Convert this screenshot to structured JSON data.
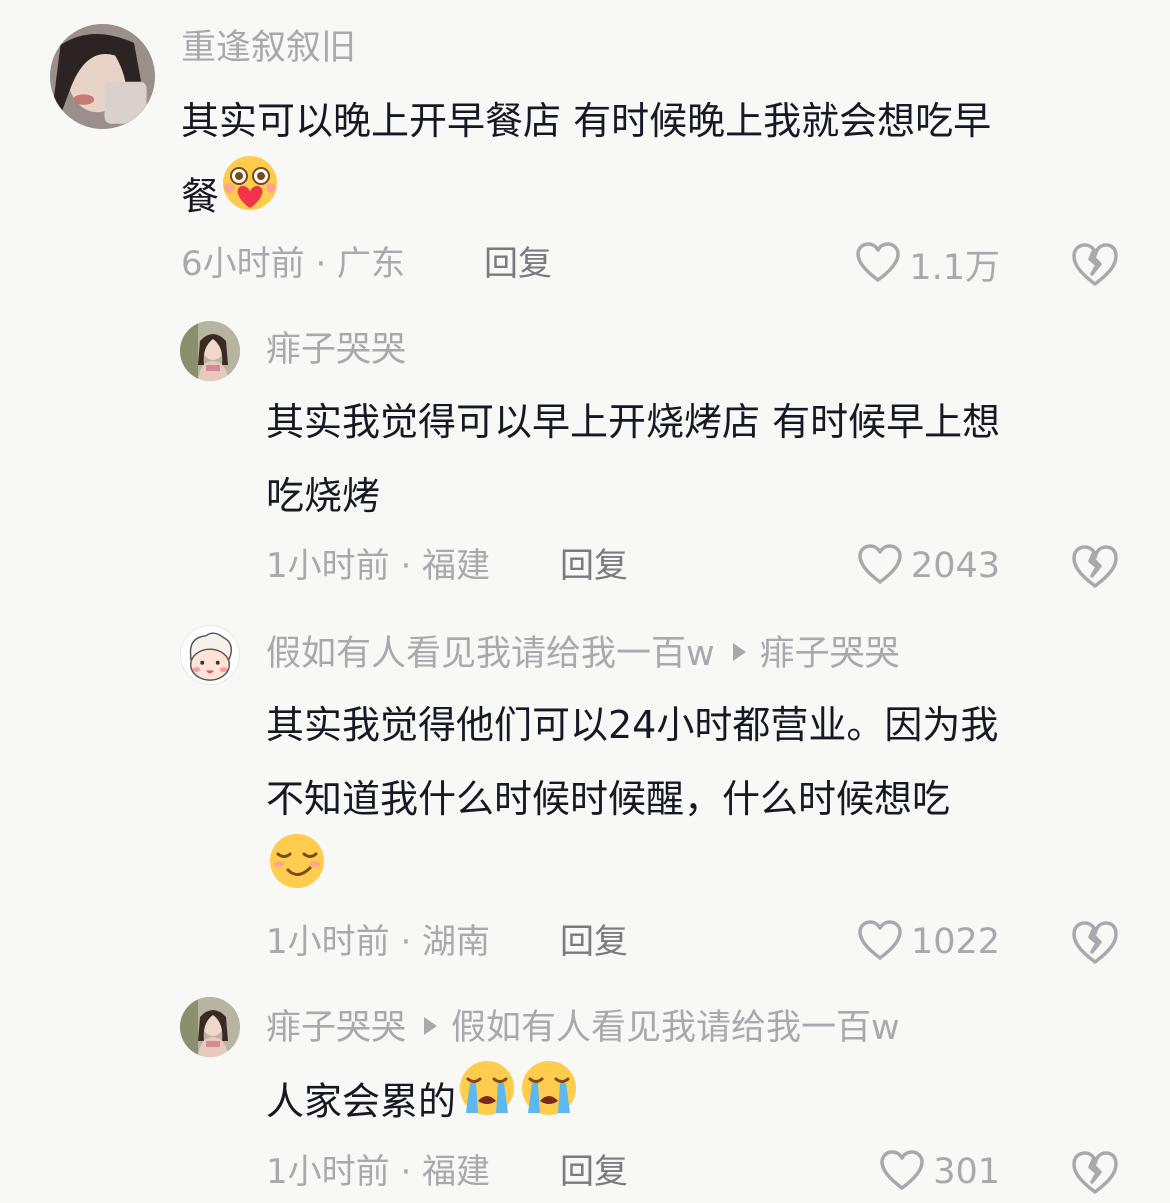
{
  "comments": [
    {
      "username": "重逢叙叙旧",
      "text_lines": [
        "其实可以晚上开早餐店 有时候晚上我就会想吃早",
        "餐"
      ],
      "emojis": [
        "heart-eyes-emoji"
      ],
      "time_location": "6小时前 · 广东",
      "reply_label": "回复",
      "likes": "1.1万"
    },
    {
      "username": "痱子哭哭",
      "text_lines": [
        "其实我觉得可以早上开烧烤店 有时候早上想",
        "吃烧烤"
      ],
      "time_location": "1小时前 · 福建",
      "reply_label": "回复",
      "likes": "2043"
    },
    {
      "username": "假如有人看见我请给我一百w",
      "reply_to": "痱子哭哭",
      "text_lines": [
        "其实我觉得他们可以24小时都营业。因为我",
        "不知道我什么时候时候醒，什么时候想吃"
      ],
      "emojis": [
        "smug-smile-emoji"
      ],
      "time_location": "1小时前 · 湖南",
      "reply_label": "回复",
      "likes": "1022"
    },
    {
      "username": "痱子哭哭",
      "reply_to": "假如有人看见我请给我一百w",
      "text_lines": [
        "人家会累的"
      ],
      "emojis": [
        "crying-emoji",
        "crying-emoji"
      ],
      "time_location": "1小时前 · 福建",
      "reply_label": "回复",
      "likes": "301"
    }
  ],
  "colors": {
    "background": "#f8f8f6",
    "text": "#161823",
    "muted": "#a9a9ad",
    "reply": "#7a7a7f"
  }
}
